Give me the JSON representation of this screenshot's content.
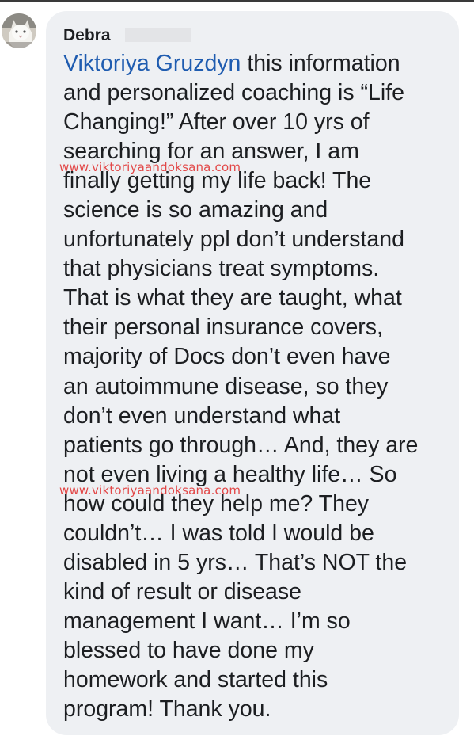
{
  "author": {
    "name": "Debra"
  },
  "comment": {
    "mention": "Viktoriya Gruzdyn",
    "lines": [
      " this information",
      "and personalized coaching is “Life",
      "Changing!”  After over 10 yrs of",
      "searching for an answer, I am",
      "finally getting my life back! The",
      "science is so amazing and",
      "unfortunately ppl don’t understand",
      "that physicians treat symptoms.",
      "That is what they are taught, what",
      "their personal insurance covers,",
      "majority of Docs don’t even have",
      "an autoimmune disease, so they",
      "don’t even understand what",
      "patients go through… And, they are",
      "not even living a healthy life… So",
      "how could they help me? They",
      "couldn’t… I was told I would be",
      "disabled in 5 yrs… That’s NOT the",
      "kind of result or disease",
      "management I want… I’m so",
      "blessed to have done my",
      "homework and started this",
      "program! Thank you."
    ]
  },
  "watermark": {
    "text": "www.viktoriyaandoksana.com",
    "color": "#e23a3a"
  },
  "colors": {
    "bubble": "#eef0f3",
    "mention": "#1f5cb0",
    "text": "#1c1e21"
  }
}
